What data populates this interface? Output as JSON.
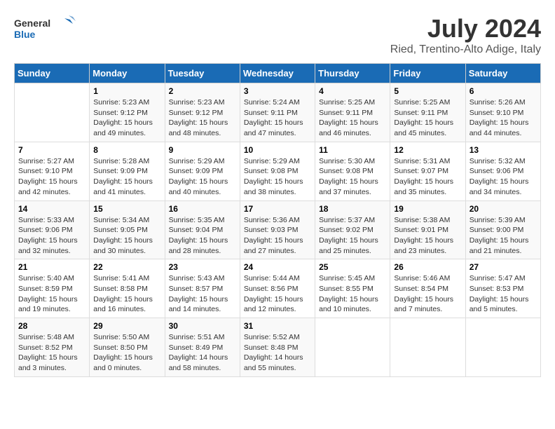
{
  "header": {
    "logo_line1": "General",
    "logo_line2": "Blue",
    "title": "July 2024",
    "subtitle": "Ried, Trentino-Alto Adige, Italy"
  },
  "days_of_week": [
    "Sunday",
    "Monday",
    "Tuesday",
    "Wednesday",
    "Thursday",
    "Friday",
    "Saturday"
  ],
  "weeks": [
    [
      {
        "num": "",
        "detail": ""
      },
      {
        "num": "1",
        "detail": "Sunrise: 5:23 AM\nSunset: 9:12 PM\nDaylight: 15 hours\nand 49 minutes."
      },
      {
        "num": "2",
        "detail": "Sunrise: 5:23 AM\nSunset: 9:12 PM\nDaylight: 15 hours\nand 48 minutes."
      },
      {
        "num": "3",
        "detail": "Sunrise: 5:24 AM\nSunset: 9:11 PM\nDaylight: 15 hours\nand 47 minutes."
      },
      {
        "num": "4",
        "detail": "Sunrise: 5:25 AM\nSunset: 9:11 PM\nDaylight: 15 hours\nand 46 minutes."
      },
      {
        "num": "5",
        "detail": "Sunrise: 5:25 AM\nSunset: 9:11 PM\nDaylight: 15 hours\nand 45 minutes."
      },
      {
        "num": "6",
        "detail": "Sunrise: 5:26 AM\nSunset: 9:10 PM\nDaylight: 15 hours\nand 44 minutes."
      }
    ],
    [
      {
        "num": "7",
        "detail": "Sunrise: 5:27 AM\nSunset: 9:10 PM\nDaylight: 15 hours\nand 42 minutes."
      },
      {
        "num": "8",
        "detail": "Sunrise: 5:28 AM\nSunset: 9:09 PM\nDaylight: 15 hours\nand 41 minutes."
      },
      {
        "num": "9",
        "detail": "Sunrise: 5:29 AM\nSunset: 9:09 PM\nDaylight: 15 hours\nand 40 minutes."
      },
      {
        "num": "10",
        "detail": "Sunrise: 5:29 AM\nSunset: 9:08 PM\nDaylight: 15 hours\nand 38 minutes."
      },
      {
        "num": "11",
        "detail": "Sunrise: 5:30 AM\nSunset: 9:08 PM\nDaylight: 15 hours\nand 37 minutes."
      },
      {
        "num": "12",
        "detail": "Sunrise: 5:31 AM\nSunset: 9:07 PM\nDaylight: 15 hours\nand 35 minutes."
      },
      {
        "num": "13",
        "detail": "Sunrise: 5:32 AM\nSunset: 9:06 PM\nDaylight: 15 hours\nand 34 minutes."
      }
    ],
    [
      {
        "num": "14",
        "detail": "Sunrise: 5:33 AM\nSunset: 9:06 PM\nDaylight: 15 hours\nand 32 minutes."
      },
      {
        "num": "15",
        "detail": "Sunrise: 5:34 AM\nSunset: 9:05 PM\nDaylight: 15 hours\nand 30 minutes."
      },
      {
        "num": "16",
        "detail": "Sunrise: 5:35 AM\nSunset: 9:04 PM\nDaylight: 15 hours\nand 28 minutes."
      },
      {
        "num": "17",
        "detail": "Sunrise: 5:36 AM\nSunset: 9:03 PM\nDaylight: 15 hours\nand 27 minutes."
      },
      {
        "num": "18",
        "detail": "Sunrise: 5:37 AM\nSunset: 9:02 PM\nDaylight: 15 hours\nand 25 minutes."
      },
      {
        "num": "19",
        "detail": "Sunrise: 5:38 AM\nSunset: 9:01 PM\nDaylight: 15 hours\nand 23 minutes."
      },
      {
        "num": "20",
        "detail": "Sunrise: 5:39 AM\nSunset: 9:00 PM\nDaylight: 15 hours\nand 21 minutes."
      }
    ],
    [
      {
        "num": "21",
        "detail": "Sunrise: 5:40 AM\nSunset: 8:59 PM\nDaylight: 15 hours\nand 19 minutes."
      },
      {
        "num": "22",
        "detail": "Sunrise: 5:41 AM\nSunset: 8:58 PM\nDaylight: 15 hours\nand 16 minutes."
      },
      {
        "num": "23",
        "detail": "Sunrise: 5:43 AM\nSunset: 8:57 PM\nDaylight: 15 hours\nand 14 minutes."
      },
      {
        "num": "24",
        "detail": "Sunrise: 5:44 AM\nSunset: 8:56 PM\nDaylight: 15 hours\nand 12 minutes."
      },
      {
        "num": "25",
        "detail": "Sunrise: 5:45 AM\nSunset: 8:55 PM\nDaylight: 15 hours\nand 10 minutes."
      },
      {
        "num": "26",
        "detail": "Sunrise: 5:46 AM\nSunset: 8:54 PM\nDaylight: 15 hours\nand 7 minutes."
      },
      {
        "num": "27",
        "detail": "Sunrise: 5:47 AM\nSunset: 8:53 PM\nDaylight: 15 hours\nand 5 minutes."
      }
    ],
    [
      {
        "num": "28",
        "detail": "Sunrise: 5:48 AM\nSunset: 8:52 PM\nDaylight: 15 hours\nand 3 minutes."
      },
      {
        "num": "29",
        "detail": "Sunrise: 5:50 AM\nSunset: 8:50 PM\nDaylight: 15 hours\nand 0 minutes."
      },
      {
        "num": "30",
        "detail": "Sunrise: 5:51 AM\nSunset: 8:49 PM\nDaylight: 14 hours\nand 58 minutes."
      },
      {
        "num": "31",
        "detail": "Sunrise: 5:52 AM\nSunset: 8:48 PM\nDaylight: 14 hours\nand 55 minutes."
      },
      {
        "num": "",
        "detail": ""
      },
      {
        "num": "",
        "detail": ""
      },
      {
        "num": "",
        "detail": ""
      }
    ]
  ]
}
